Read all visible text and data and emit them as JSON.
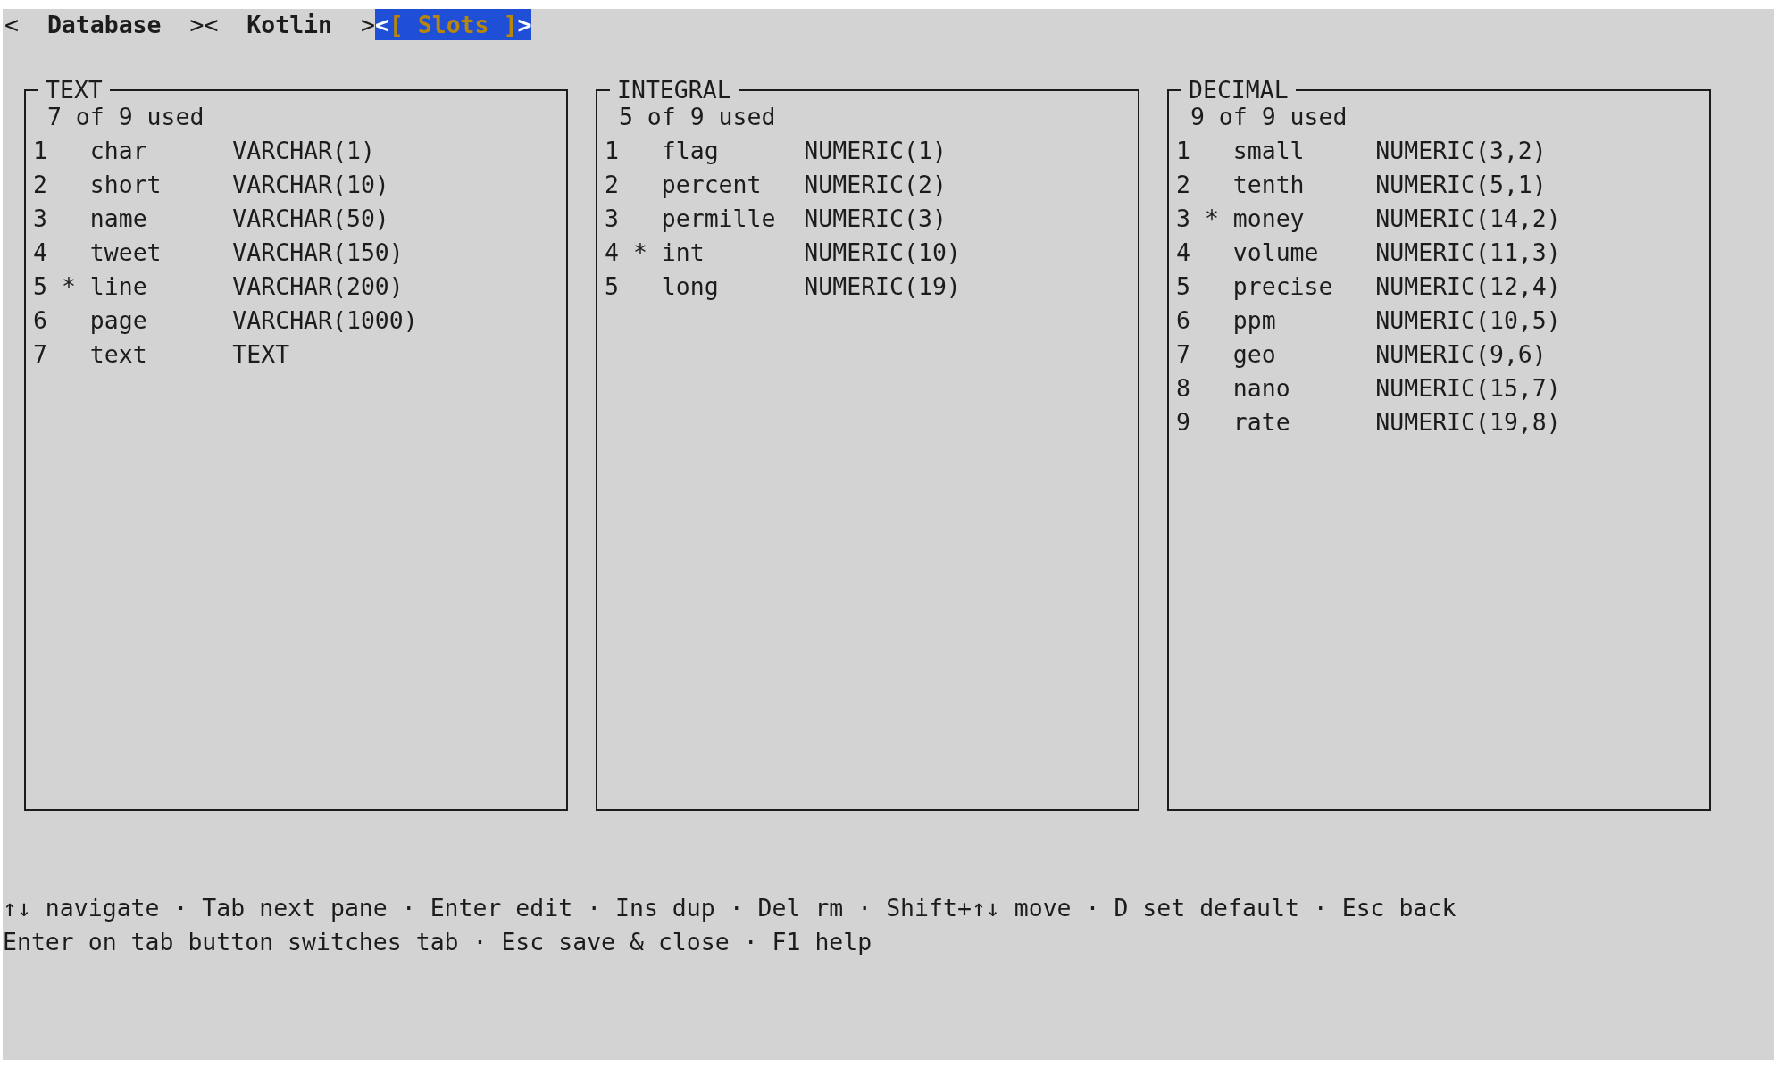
{
  "tabs": [
    {
      "left": "<",
      "label": "Database",
      "right": ">",
      "selected": false
    },
    {
      "left": "<",
      "label": "Kotlin",
      "right": ">",
      "selected": false
    },
    {
      "left": "<",
      "label": "[ Slots ]",
      "right": ">",
      "selected": true
    }
  ],
  "panes": [
    {
      "title": "TEXT",
      "count": "7 of 9 used",
      "rows": [
        {
          "number": "1",
          "name": "char",
          "type": "VARCHAR(1)"
        },
        {
          "number": "2",
          "name": "short",
          "type": "VARCHAR(10)"
        },
        {
          "number": "3",
          "name": "name",
          "type": "VARCHAR(50)"
        },
        {
          "number": "4",
          "name": "tweet",
          "type": "VARCHAR(150)"
        },
        {
          "number": "5",
          "marker": "*",
          "name": "line",
          "type": "VARCHAR(200)"
        },
        {
          "number": "6",
          "name": "page",
          "type": "VARCHAR(1000)"
        },
        {
          "number": "7",
          "name": "text",
          "type": "TEXT"
        }
      ]
    },
    {
      "title": "INTEGRAL",
      "count": "5 of 9 used",
      "rows": [
        {
          "number": "1",
          "name": "flag",
          "type": "NUMERIC(1)"
        },
        {
          "number": "2",
          "name": "percent",
          "type": "NUMERIC(2)"
        },
        {
          "number": "3",
          "name": "permille",
          "type": "NUMERIC(3)"
        },
        {
          "number": "4",
          "marker": "*",
          "name": "int",
          "type": "NUMERIC(10)"
        },
        {
          "number": "5",
          "name": "long",
          "type": "NUMERIC(19)"
        }
      ]
    },
    {
      "title": "DECIMAL",
      "count": "9 of 9 used",
      "rows": [
        {
          "number": "1",
          "name": "small",
          "type": "NUMERIC(3,2)"
        },
        {
          "number": "2",
          "name": "tenth",
          "type": "NUMERIC(5,1)"
        },
        {
          "number": "3",
          "marker": "*",
          "name": "money",
          "type": "NUMERIC(14,2)"
        },
        {
          "number": "4",
          "name": "volume",
          "type": "NUMERIC(11,3)"
        },
        {
          "number": "5",
          "name": "precise",
          "type": "NUMERIC(12,4)"
        },
        {
          "number": "6",
          "name": "ppm",
          "type": "NUMERIC(10,5)"
        },
        {
          "number": "7",
          "name": "geo",
          "type": "NUMERIC(9,6)"
        },
        {
          "number": "8",
          "name": "nano",
          "type": "NUMERIC(15,7)"
        },
        {
          "number": "9",
          "name": "rate",
          "type": "NUMERIC(19,8)"
        }
      ]
    }
  ],
  "help_lines": [
    "↑↓ navigate · Tab next pane · Enter edit · Ins dup · Del rm · Shift+↑↓ move · D set default · Esc back",
    "Enter on tab button switches tab · Esc save & close · F1 help"
  ]
}
